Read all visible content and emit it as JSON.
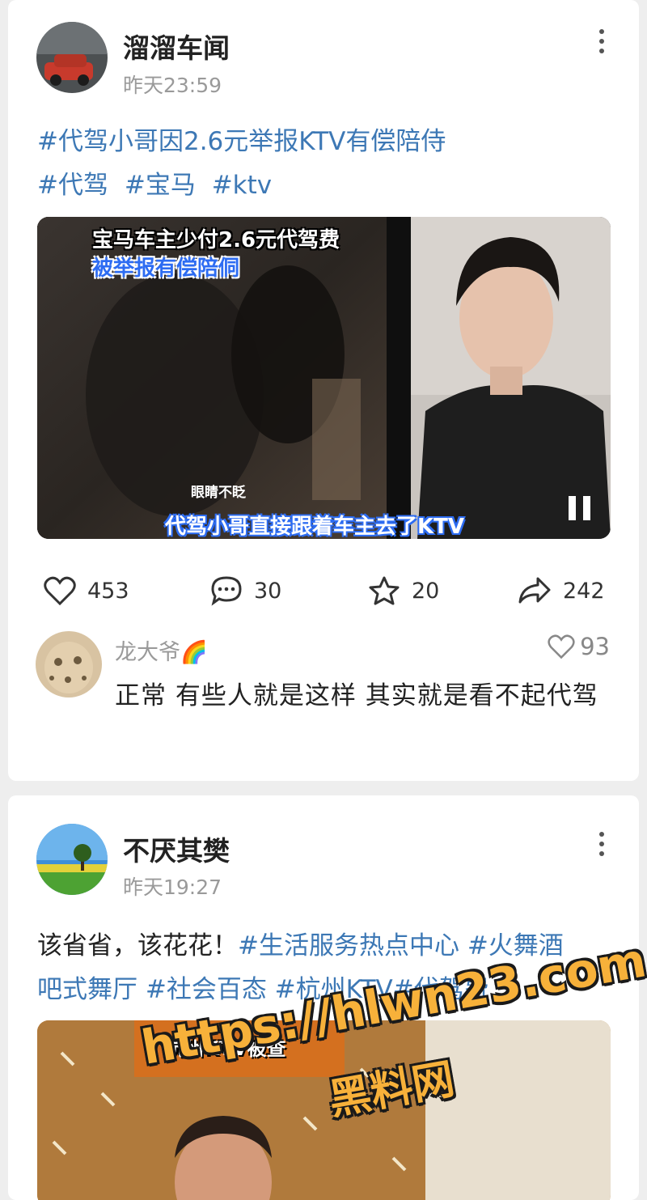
{
  "posts": [
    {
      "author": "溜溜车闻",
      "time": "昨天23:59",
      "line1": "#代驾小哥因2.6元举报KTV有偿陪侍",
      "line2_tags": [
        "#代驾",
        "#宝马",
        "#ktv"
      ],
      "video": {
        "caption_top1": "宝马车主少付2.6元代驾费",
        "caption_top2": "被举报有偿陪侗",
        "caption_mid": "眼睛不眨",
        "caption_bottom": "代驾小哥直接跟着车主去了KTV",
        "state_icon": "pause-icon"
      },
      "stats": {
        "likes": "453",
        "comments": "30",
        "favorites": "20",
        "shares": "242"
      },
      "top_comment": {
        "user": "龙大爷🌈",
        "likes": "93",
        "text": "正常  有些人就是这样  其实就是看不起代驾"
      }
    },
    {
      "author": "不厌其樊",
      "time": "昨天19:27",
      "line1_plain": "该省省，该花花！",
      "line1_tags": "#生活服务热点中心 #火舞酒",
      "line2_tags": "吧式舞厅 #社会百态 #杭州KTV#代驾费",
      "video": {
        "caption_top": "杭州KTV被查"
      }
    }
  ],
  "watermark": {
    "url": "https://hlwn23.com",
    "name": "黑料网"
  },
  "colors": {
    "tag": "#3d78b5",
    "caption_blue": "#2d6cf2",
    "watermark": "#f7b13a"
  }
}
